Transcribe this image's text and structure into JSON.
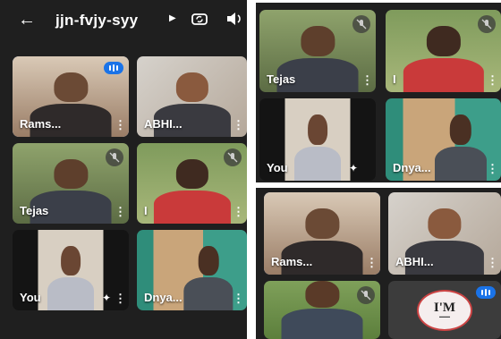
{
  "header": {
    "meeting_code": "jjn-fvjy-syy",
    "back_icon": "arrow-left-icon",
    "switch_camera_icon": "switch-camera-icon",
    "audio_icon": "speaker-icon"
  },
  "panel1": {
    "tiles": [
      {
        "name": "Rams...",
        "mic": "speaking"
      },
      {
        "name": "ABHI...",
        "mic": "none"
      },
      {
        "name": "Tejas",
        "mic": "muted"
      },
      {
        "name": "I",
        "mic": "muted"
      },
      {
        "name": "You",
        "mic": "none"
      },
      {
        "name": "Dnya...",
        "mic": "none"
      }
    ]
  },
  "panel2": {
    "tiles": [
      {
        "name": "Tejas",
        "mic": "muted"
      },
      {
        "name": "I",
        "mic": "muted"
      },
      {
        "name": "You",
        "mic": "none"
      },
      {
        "name": "Dnya...",
        "mic": "none"
      }
    ]
  },
  "panel3": {
    "tiles": [
      {
        "name": "Rams...",
        "mic": "none"
      },
      {
        "name": "ABHI...",
        "mic": "none"
      },
      {
        "name": "",
        "mic": "muted"
      },
      {
        "name": "",
        "mic": "speaking"
      }
    ],
    "badge_text": "I'M"
  },
  "icons": {
    "more": "more-vert-icon",
    "muted": "mic-off-icon",
    "speaking": "audio-level-icon",
    "effects": "sparkle-effects-icon"
  }
}
